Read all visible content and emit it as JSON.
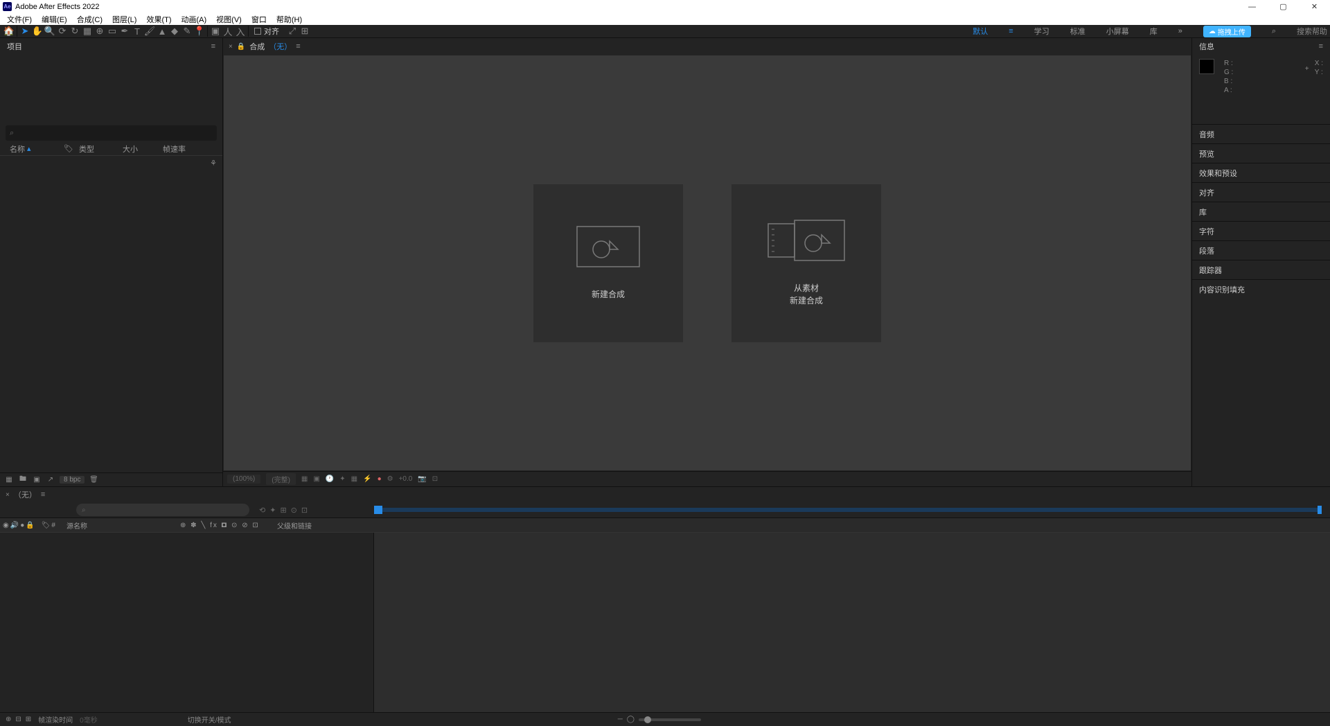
{
  "app": {
    "title": "Adobe After Effects 2022"
  },
  "menu": [
    "文件(F)",
    "编辑(E)",
    "合成(C)",
    "图层(L)",
    "效果(T)",
    "动画(A)",
    "视图(V)",
    "窗口",
    "帮助(H)"
  ],
  "toolbar": {
    "snap_label": "对齐",
    "upload_label": "拖拽上传",
    "search_help": "搜索帮助"
  },
  "workspaces": [
    "默认",
    "学习",
    "标准",
    "小屏幕",
    "库"
  ],
  "project": {
    "panel_title": "项目",
    "search_icon": "⌕",
    "cols": {
      "name": "名称",
      "type": "类型",
      "size": "大小",
      "fps": "帧速率"
    },
    "footer": {
      "bpc": "8 bpc"
    }
  },
  "comp": {
    "header_label": "合成",
    "header_none": "（无）",
    "card_new": "新建合成",
    "card_from1": "从素材",
    "card_from2": "新建合成",
    "footer": {
      "zoom": "(100%)",
      "res": "(完整)",
      "exp": "+0.0"
    }
  },
  "info": {
    "title": "信息",
    "rgb": [
      "R :",
      "G :",
      "B :",
      "A :"
    ],
    "xy": [
      "X :",
      "Y :"
    ]
  },
  "right_panels": [
    "音频",
    "预览",
    "效果和预设",
    "对齐",
    "库",
    "字符",
    "段落",
    "跟踪器",
    "内容识别填充"
  ],
  "timeline": {
    "none": "（无）",
    "cols": {
      "src": "源名称",
      "sw": "⊕ ✽ ╲ fx 🞓 ⊙ ⊘ ⊡",
      "par": "父级和链接"
    },
    "footer": {
      "render": "帧渲染时间",
      "zero": "0毫秒",
      "toggle": "切换开关/模式"
    }
  }
}
